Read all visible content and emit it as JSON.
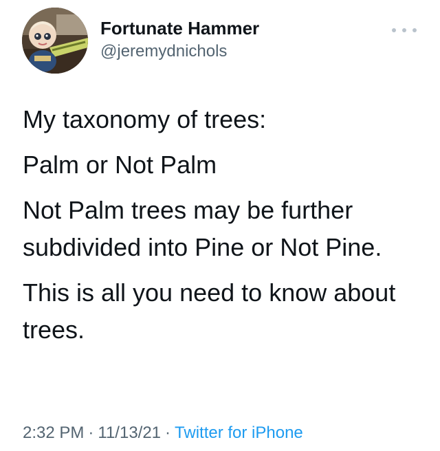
{
  "author": {
    "display_name": "Fortunate Hammer",
    "handle": "@jeremydnichols",
    "avatar_icon": "profile-photo-doll"
  },
  "tweet": {
    "paragraphs": [
      "My taxonomy of trees:",
      "Palm or Not Palm",
      "Not Palm trees may be further subdivided into Pine or Not Pine.",
      "This is all you need to know about trees."
    ],
    "time": "2:32 PM",
    "separator": "·",
    "date": "11/13/21",
    "source": "Twitter for iPhone"
  },
  "menu": {
    "icon": "more-options-icon"
  },
  "colors": {
    "text_primary": "#0f1419",
    "text_secondary": "#536471",
    "link": "#1d9bf0",
    "more_dots": "#b9c3cc"
  }
}
